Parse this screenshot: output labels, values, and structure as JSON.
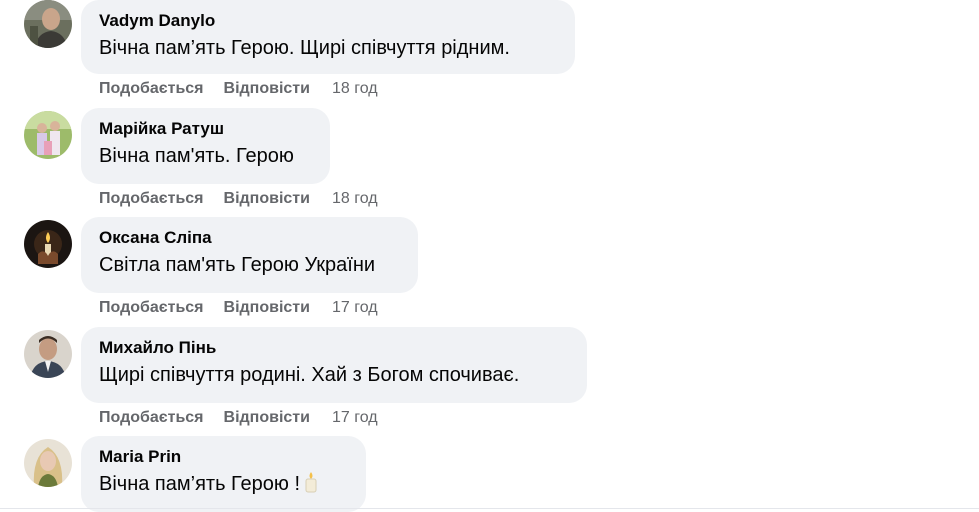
{
  "comments": [
    {
      "author": "Vadym Danylo",
      "text": "Вічна пам’ять Герою. Щирі співчуття рідним.",
      "like_label": "Подобається",
      "reply_label": "Відповісти",
      "time": "18 год",
      "avatar_icon": "man-portrait-avatar"
    },
    {
      "author": "Марійка Ратуш",
      "text": "Вічна пам'ять. Герою",
      "like_label": "Подобається",
      "reply_label": "Відповісти",
      "time": "18 год",
      "avatar_icon": "family-outdoor-avatar"
    },
    {
      "author": "Оксана Сліпа",
      "text": "Світла пам'ять Герою України",
      "like_label": "Подобається",
      "reply_label": "Відповісти",
      "time": "17 год",
      "avatar_icon": "candle-dark-avatar"
    },
    {
      "author": "Михайло Пінь",
      "text": "Щирі співчуття родині. Хай з Богом спочиває.",
      "like_label": "Подобається",
      "reply_label": "Відповісти",
      "time": "17 год",
      "avatar_icon": "man-suit-avatar"
    },
    {
      "author": "Maria Prin",
      "text": "Вічна пам’ять Герою !",
      "avatar_icon": "woman-blonde-avatar",
      "emoji_icon": "candle-icon"
    }
  ]
}
